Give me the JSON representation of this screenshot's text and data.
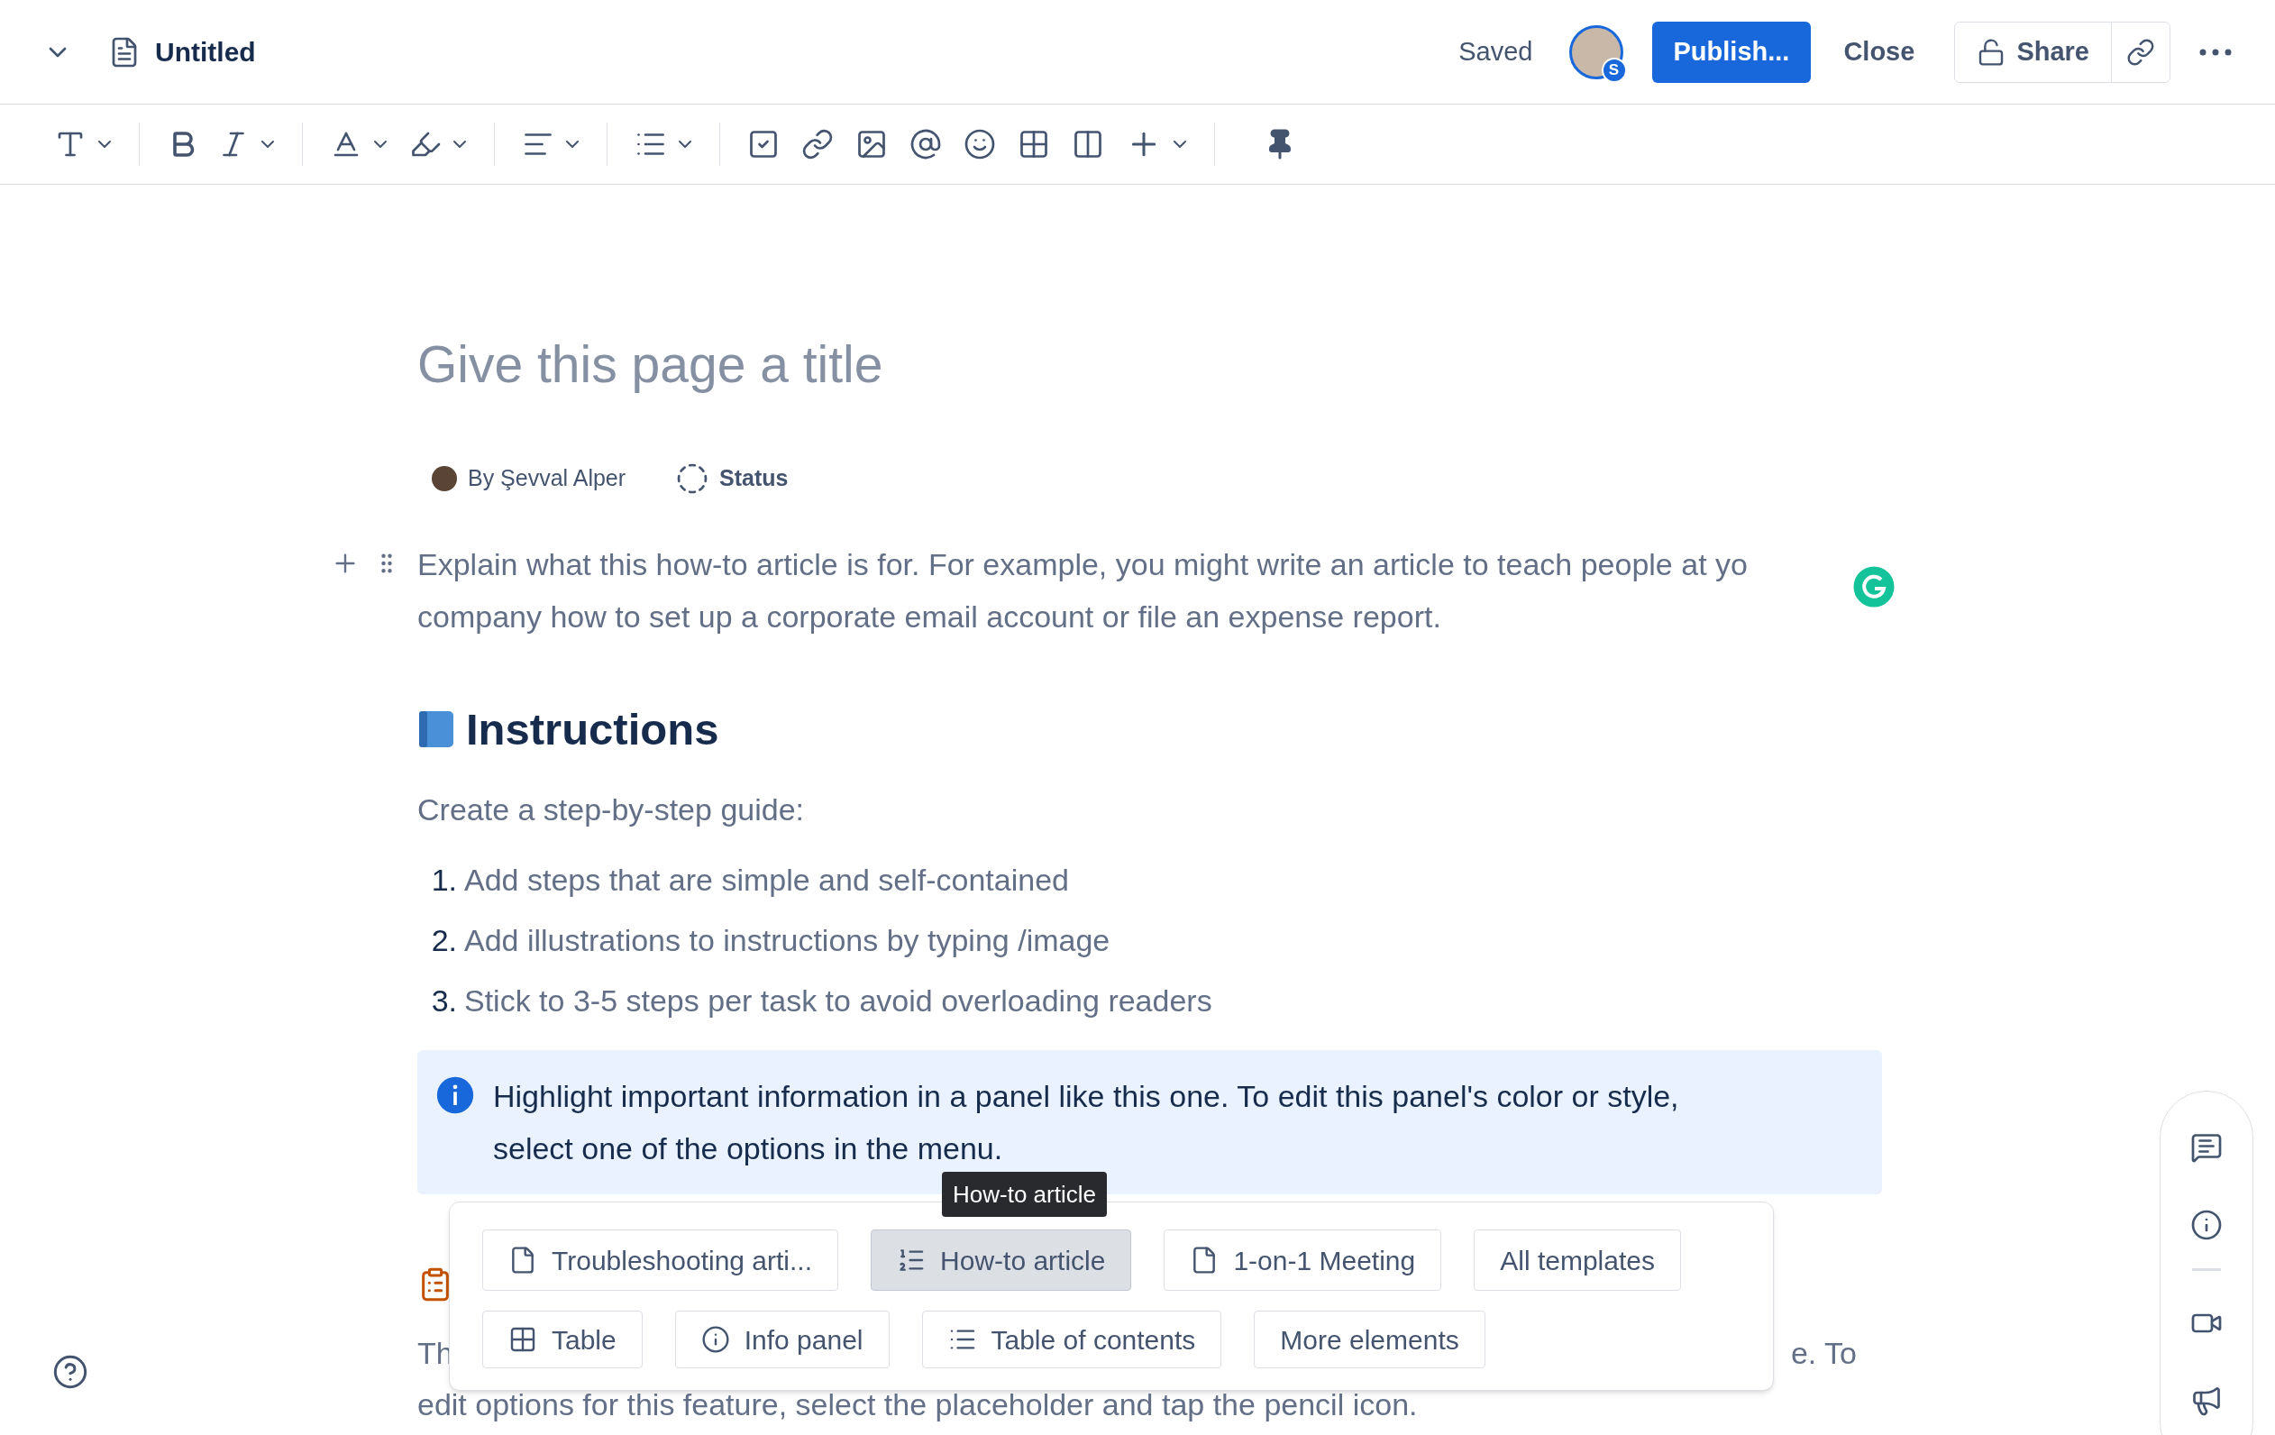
{
  "header": {
    "title": "Untitled",
    "status": "Saved",
    "avatar_badge": "S",
    "buttons": [
      {
        "label": "Publish...",
        "kind": "primary"
      },
      {
        "label": "Close",
        "kind": "plain"
      },
      {
        "label": "Share",
        "kind": "share"
      }
    ]
  },
  "page": {
    "title_placeholder": "Give this page a title",
    "byline": "By Şevval Alper",
    "status": "Status",
    "intro_lines": [
      "Explain what this how-to article is for. For example, you might write an article to teach people at yo",
      "company how to set up a corporate email account or file an expense report."
    ],
    "heading": "Instructions",
    "lead": "Create a step-by-step guide:",
    "steps": [
      {
        "number": "1.",
        "text": "Add steps that are simple and self-contained"
      },
      {
        "number": "2.",
        "text": "Add illustrations to instructions by typing /image"
      },
      {
        "number": "3.",
        "text": "Stick to 3-5 steps per task to avoid overloading readers"
      }
    ],
    "info_panel": "Highlight important information in a panel like this one. To edit this panel's color or style, select one of the options in the menu.",
    "hidden_paragraph": {
      "start": "Th",
      "end": "e. To",
      "line_2": "edit options for this feature, select the placeholder and tap the pencil icon."
    }
  },
  "popup": {
    "tooltip": "How-to article",
    "templates": [
      {
        "label": "Troubleshooting arti...",
        "kind": "page",
        "selected": false
      },
      {
        "label": "How-to article",
        "kind": "numbered",
        "selected": true
      },
      {
        "label": "1-on-1 Meeting",
        "kind": "page",
        "selected": false
      },
      {
        "label": "All templates",
        "kind": "none",
        "selected": false
      }
    ],
    "elements": [
      {
        "label": "Table",
        "kind": "table"
      },
      {
        "label": "Info panel",
        "kind": "info"
      },
      {
        "label": "Table of contents",
        "kind": "list"
      },
      {
        "label": "More elements",
        "kind": "none"
      }
    ]
  }
}
